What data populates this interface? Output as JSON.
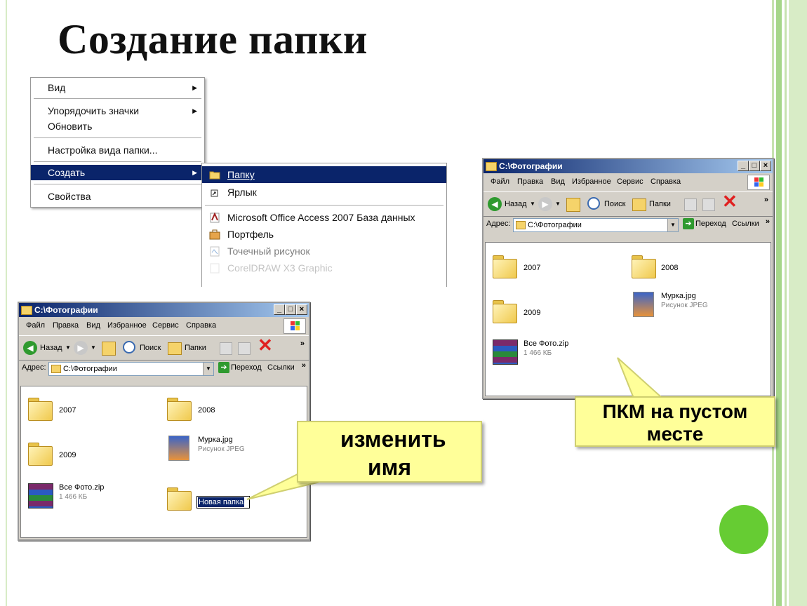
{
  "slide_title": "Создание папки",
  "context_menu": {
    "items": [
      "Вид",
      "Упорядочить значки",
      "Обновить",
      "Настройка вида папки...",
      "Создать",
      "Свойства"
    ],
    "submenu_arrow": "▶"
  },
  "create_submenu": {
    "items": [
      "Папку",
      "Ярлык",
      "Microsoft Office Access 2007 База данных",
      "Портфель",
      "Точечный рисунок",
      "CorelDRAW X3 Graphic"
    ]
  },
  "explorer": {
    "title": "C:\\Фотографии",
    "menu": [
      "Файл",
      "Правка",
      "Вид",
      "Избранное",
      "Сервис",
      "Справка"
    ],
    "toolbar": {
      "back": "Назад",
      "search": "Поиск",
      "folders": "Папки"
    },
    "address_label": "Адрес:",
    "address_value": "C:\\Фотографии",
    "go": "Переход",
    "links": "Ссылки",
    "chevron": "»",
    "win_buttons": [
      "_",
      "□",
      "×"
    ],
    "items": {
      "f2007": "2007",
      "f2008": "2008",
      "f2009": "2009",
      "murka_name": "Мурка.jpg",
      "murka_type": "Рисунок JPEG",
      "zip_name": "Все Фото.zip",
      "zip_size": "1 466 КБ"
    },
    "new_folder_name": "Новая папка"
  },
  "callouts": {
    "rename": "изменить имя",
    "rmb": "ПКМ на пустом месте"
  },
  "colors": {
    "accent_green": "#66cc33",
    "selection_blue": "#0a246a",
    "callout_yellow": "#ffff99"
  }
}
